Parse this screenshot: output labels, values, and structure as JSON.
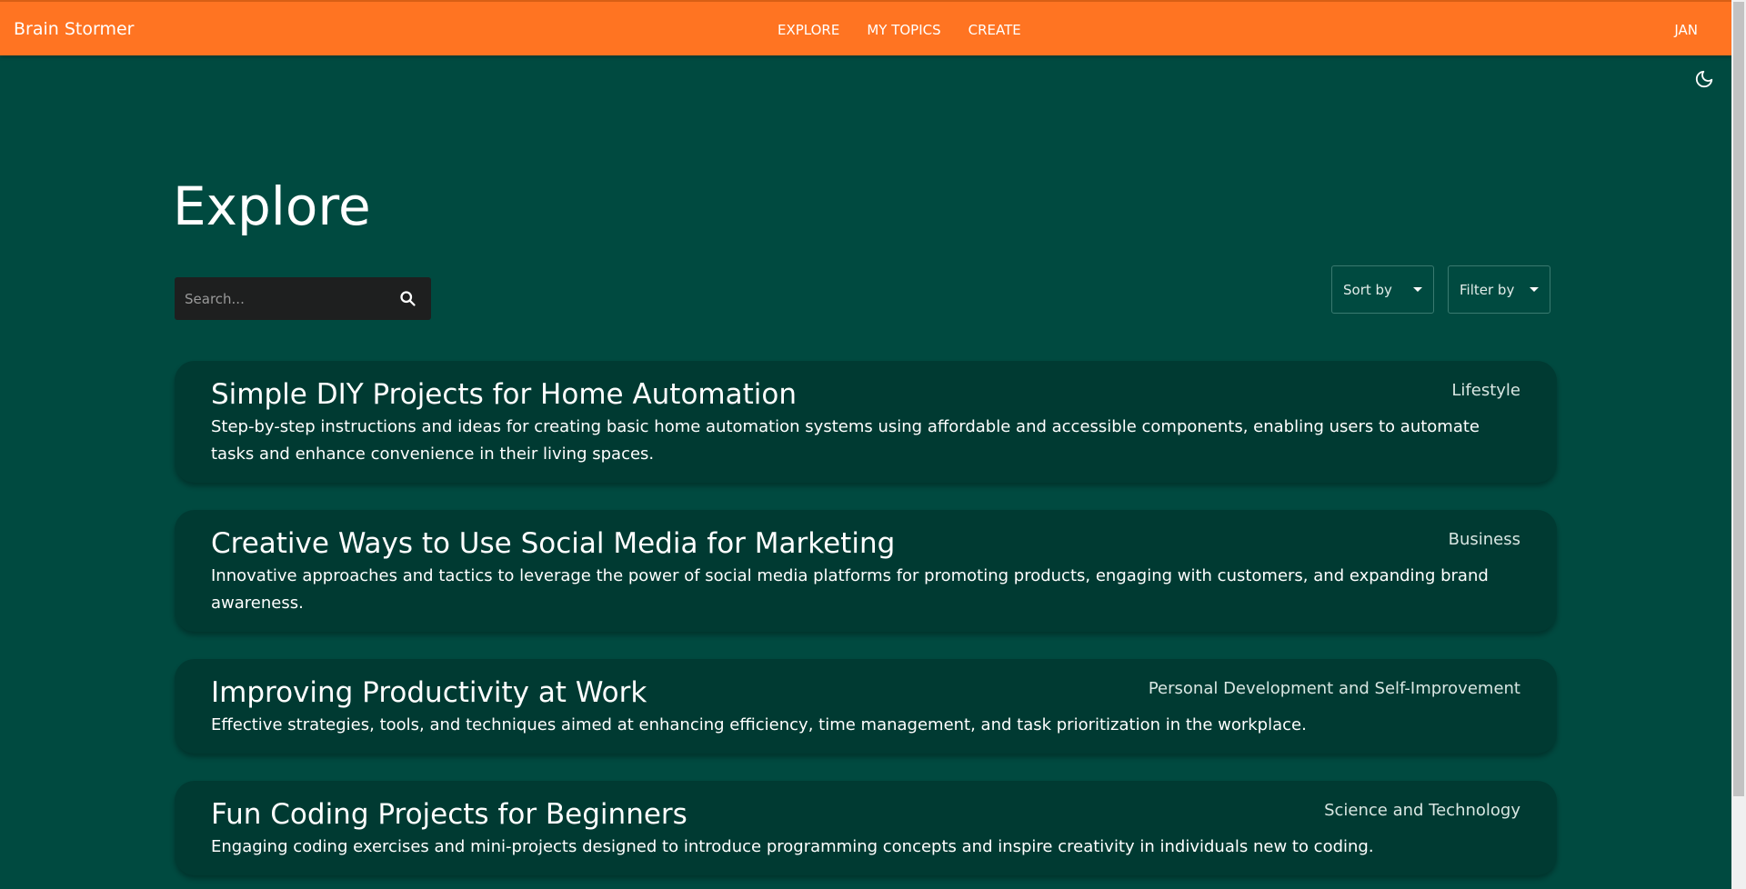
{
  "header": {
    "brand": "Brain Stormer",
    "nav": [
      "EXPLORE",
      "MY TOPICS",
      "CREATE"
    ],
    "user": "JAN"
  },
  "page": {
    "title": "Explore"
  },
  "search": {
    "placeholder": "Search...",
    "value": ""
  },
  "controls": {
    "sort_label": "Sort by",
    "filter_label": "Filter by"
  },
  "topics": [
    {
      "title": "Simple DIY Projects for Home Automation",
      "category": "Lifestyle",
      "description": "Step-by-step instructions and ideas for creating basic home automation systems using affordable and accessible components, enabling users to automate tasks and enhance convenience in their living spaces."
    },
    {
      "title": "Creative Ways to Use Social Media for Marketing",
      "category": "Business",
      "description": "Innovative approaches and tactics to leverage the power of social media platforms for promoting products, engaging with customers, and expanding brand awareness."
    },
    {
      "title": "Improving Productivity at Work",
      "category": "Personal Development and Self-Improvement",
      "description": "Effective strategies, tools, and techniques aimed at enhancing efficiency, time management, and task prioritization in the workplace."
    },
    {
      "title": "Fun Coding Projects for Beginners",
      "category": "Science and Technology",
      "description": "Engaging coding exercises and mini-projects designed to introduce programming concepts and inspire creativity in individuals new to coding."
    }
  ],
  "icons": {
    "theme_toggle": "moon-icon",
    "search": "search-icon",
    "dropdown": "caret-down-icon"
  },
  "colors": {
    "header": "#ff7422",
    "background": "#004a40",
    "card": "#003a32",
    "search_box": "#1e1f1f"
  }
}
